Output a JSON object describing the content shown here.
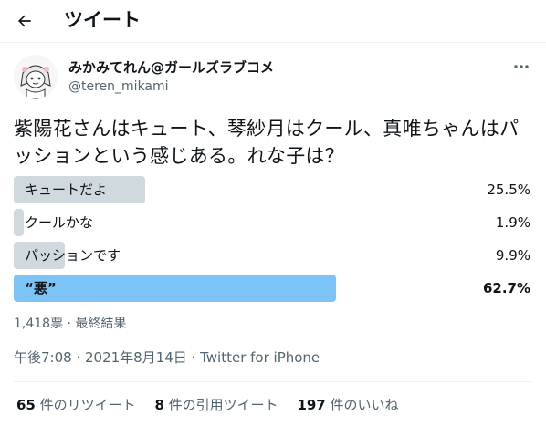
{
  "header": {
    "title": "ツイート",
    "back_icon": "arrow-left-icon"
  },
  "author": {
    "display_name": "みかみてれん@ガールズラブコメ",
    "handle": "@teren_mikami"
  },
  "tweet": {
    "text": "紫陽花さんはキュート、琴紗月はクール、真唯ちゃんはパッションという感じある。れな子は？"
  },
  "poll": {
    "options": [
      {
        "label": "キュートだよ",
        "percent": 25.5,
        "percent_text": "25.5%",
        "winner": false
      },
      {
        "label": "クールかな",
        "percent": 1.9,
        "percent_text": "1.9%",
        "winner": false
      },
      {
        "label": "パッションです",
        "percent": 9.9,
        "percent_text": "9.9%",
        "winner": false
      },
      {
        "label": "“悪”",
        "percent": 62.7,
        "percent_text": "62.7%",
        "winner": true
      }
    ],
    "meta": "1,418票 · 最終結果"
  },
  "timestamp": "午後7:08 · 2021年8月14日 · Twitter for iPhone",
  "stats": {
    "retweets_count": "65",
    "retweets_label": " 件のリツイート",
    "quotes_count": "8",
    "quotes_label": " 件の引用ツイート",
    "likes_count": "197",
    "likes_label": " 件のいいね"
  },
  "colors": {
    "bar_default": "#cfd9de",
    "bar_winner": "#7cc4f7",
    "secondary_text": "#536471"
  }
}
